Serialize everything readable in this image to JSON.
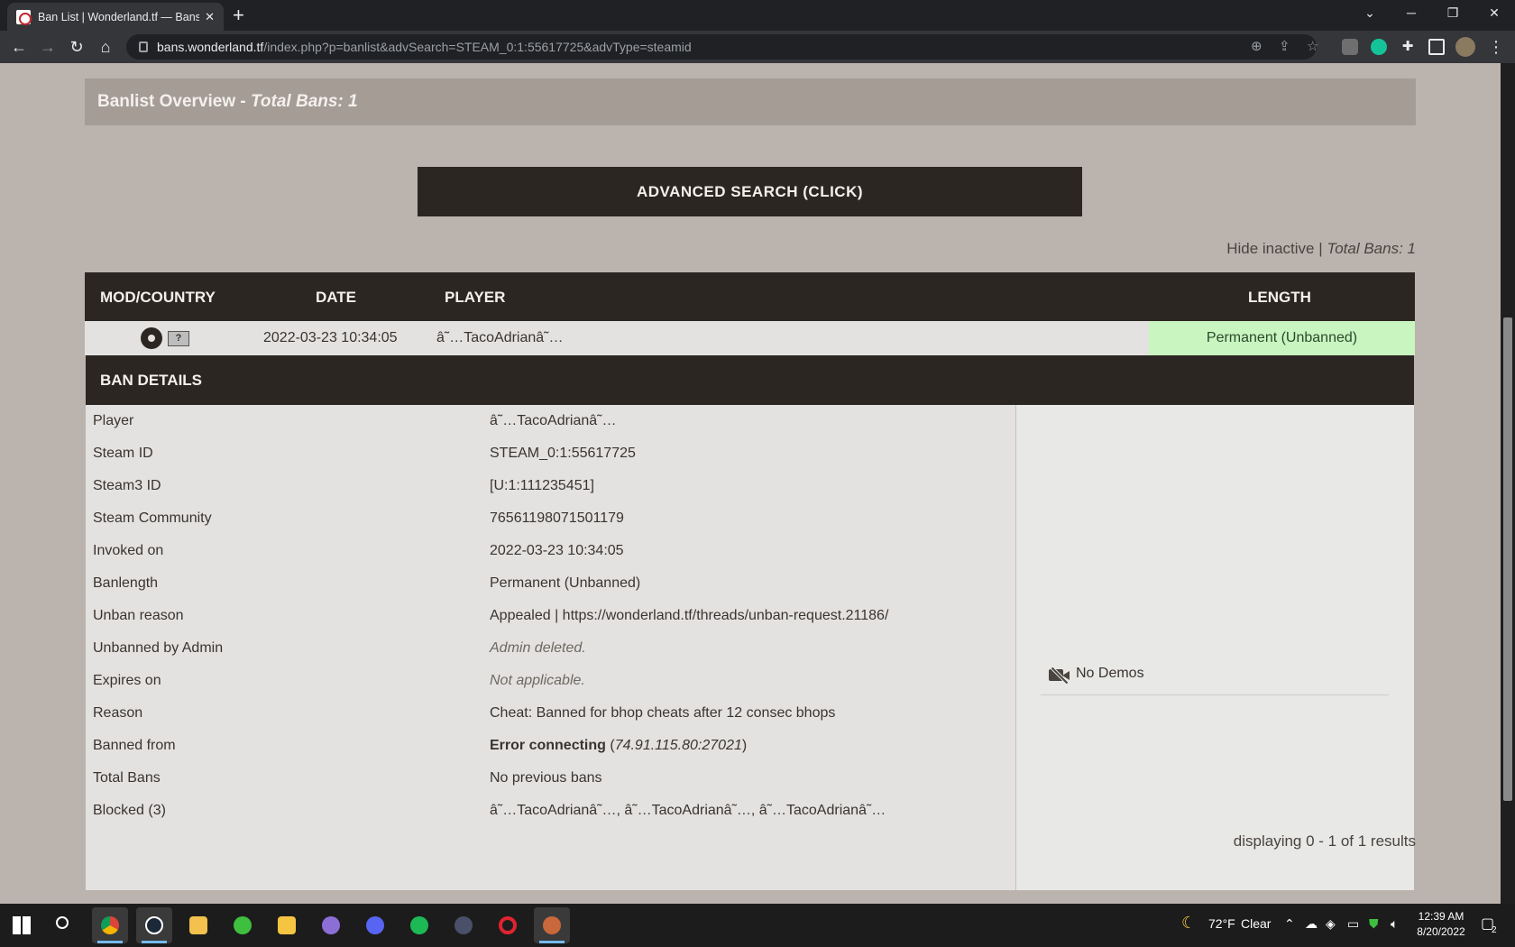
{
  "browser": {
    "tab_title": "Ban List | Wonderland.tf — Bans",
    "new_tab_label": "+",
    "url_host": "bans.wonderland.tf",
    "url_path": "/index.php?p=banlist&advSearch=STEAM_0:1:55617725&advType=steamid"
  },
  "overview": {
    "label": "Banlist Overview - ",
    "total": "Total Bans: 1"
  },
  "advanced_search_label": "ADVANCED SEARCH (CLICK)",
  "filter": {
    "hide_inactive": "Hide inactive",
    "separator": " | ",
    "total": "Total Bans: 1"
  },
  "table": {
    "headers": {
      "mod_country": "MOD/COUNTRY",
      "date": "DATE",
      "player": "PLAYER",
      "length": "LENGTH"
    },
    "row": {
      "flag": "?",
      "date": "2022-03-23 10:34:05",
      "player": "â˜…TacoAdrianâ˜…",
      "length": "Permanent (Unbanned)"
    }
  },
  "ban_details": {
    "title": "BAN DETAILS",
    "rows": [
      {
        "key": "Player",
        "value": "â˜…TacoAdrianâ˜…"
      },
      {
        "key": "Steam ID",
        "value": "STEAM_0:1:55617725"
      },
      {
        "key": "Steam3 ID",
        "value": "[U:1:111235451]"
      },
      {
        "key": "Steam Community",
        "value": "76561198071501179"
      },
      {
        "key": "Invoked on",
        "value": "2022-03-23 10:34:05"
      },
      {
        "key": "Banlength",
        "value": "Permanent (Unbanned)"
      },
      {
        "key": "Unban reason",
        "value": "Appealed | https://wonderland.tf/threads/unban-request.21186/"
      },
      {
        "key": "Unbanned by Admin",
        "value": "Admin deleted."
      },
      {
        "key": "Expires on",
        "value": "Not applicable."
      },
      {
        "key": "Reason",
        "value": "Cheat: Banned for bhop cheats after 12 consec bhops"
      },
      {
        "key": "Banned from",
        "value_bold": "Error connecting",
        "value_rest_open": " (",
        "value_italic": "74.91.115.80:27021",
        "value_rest_close": ")"
      },
      {
        "key": "Total Bans",
        "value": "No previous bans"
      },
      {
        "key": "Blocked (3)",
        "value": "â˜…TacoAdrianâ˜…, â˜…TacoAdrianâ˜…, â˜…TacoAdrianâ˜…"
      }
    ],
    "demos": "No Demos"
  },
  "pagination": "displaying 0 - 1 of 1 results",
  "taskbar": {
    "weather_temp": "72°F",
    "weather_text": "Clear",
    "time": "12:39 AM",
    "date": "8/20/2022",
    "notifications": "2"
  },
  "colors": {
    "page_bg": "#bbb3ad",
    "dark_header": "#2b2622",
    "length_cell": "#c8f5c0"
  }
}
